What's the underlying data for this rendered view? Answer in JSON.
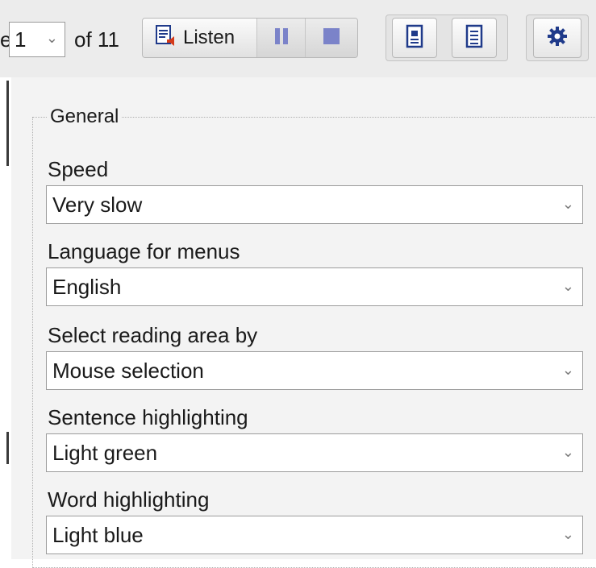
{
  "toolbar": {
    "page_prefix": "e",
    "page_number": "1",
    "page_of": "of 11",
    "listen_label": "Listen",
    "icons": {
      "listen": "document-speaker-icon",
      "pause": "pause-icon",
      "stop": "stop-icon",
      "view_page": "page-view-icon",
      "view_text": "text-view-icon",
      "settings": "gear-icon"
    }
  },
  "settings": {
    "group_title": "General",
    "fields": [
      {
        "label": "Speed",
        "value": "Very slow"
      },
      {
        "label": "Language for menus",
        "value": "English"
      },
      {
        "label": "Select reading area by",
        "value": "Mouse selection"
      },
      {
        "label": "Sentence highlighting",
        "value": "Light green"
      },
      {
        "label": "Word highlighting",
        "value": "Light blue"
      }
    ]
  },
  "colors": {
    "toolbar_bg": "#ececec",
    "panel_bg": "#f3f3f3",
    "icon_blue": "#1f3a8a",
    "icon_muted": "#7b83c9"
  }
}
